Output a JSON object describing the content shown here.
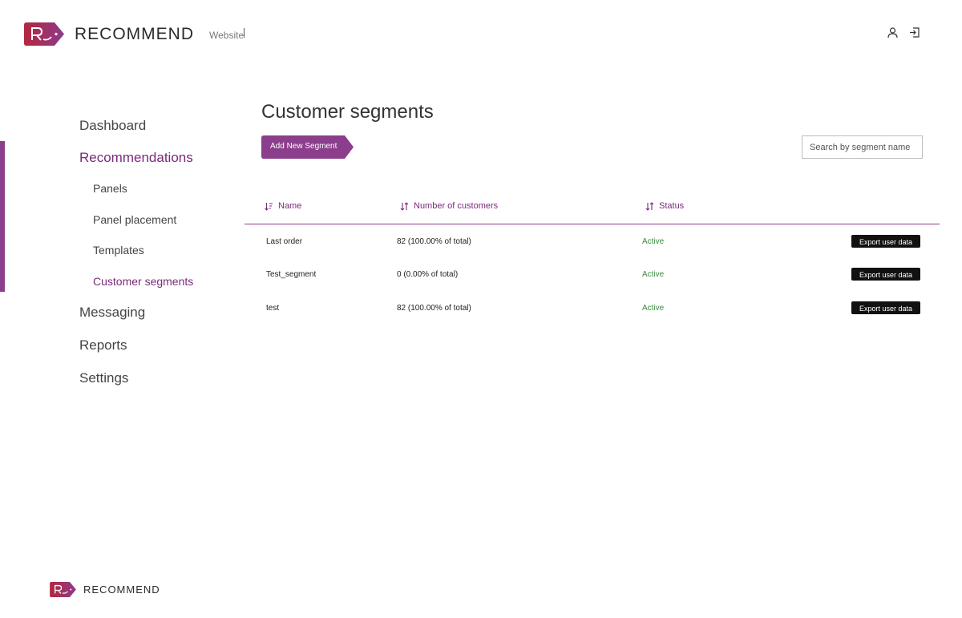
{
  "header": {
    "brand": "RECOMMEND",
    "website_label": "Website",
    "icons": [
      "user-icon",
      "logout-icon"
    ]
  },
  "sidebar": {
    "items": [
      {
        "label": "Dashboard",
        "level": "top",
        "active": false
      },
      {
        "label": "Recommendations",
        "level": "top",
        "active": true
      },
      {
        "label": "Panels",
        "level": "sub",
        "active": false
      },
      {
        "label": "Panel placement",
        "level": "sub",
        "active": false
      },
      {
        "label": "Templates",
        "level": "sub",
        "active": false
      },
      {
        "label": "Customer segments",
        "level": "sub",
        "active": true
      },
      {
        "label": "Messaging",
        "level": "top",
        "active": false
      },
      {
        "label": "Reports",
        "level": "top",
        "active": false
      },
      {
        "label": "Settings",
        "level": "top",
        "active": false
      }
    ]
  },
  "main": {
    "title": "Customer segments",
    "add_button_label": "Add New Segment",
    "search_placeholder": "Search by segment name",
    "search_value": ""
  },
  "table": {
    "columns": [
      {
        "label": "Name",
        "sort_icon": "sort-alpha-icon"
      },
      {
        "label": "Number of customers",
        "sort_icon": "sort-icon"
      },
      {
        "label": "Status",
        "sort_icon": "sort-icon"
      }
    ],
    "rows": [
      {
        "name": "Last order",
        "customers": "82 (100.00% of total)",
        "status": "Active",
        "action": "Export user data"
      },
      {
        "name": "Test_segment",
        "customers": "0 (0.00% of total)",
        "status": "Active",
        "action": "Export user data"
      },
      {
        "name": "test",
        "customers": "82 (100.00% of total)",
        "status": "Active",
        "action": "Export user data"
      }
    ]
  },
  "footer": {
    "brand": "RECOMMEND"
  },
  "colors": {
    "accent": "#8b3e8b",
    "accent_text": "#7a2a7a",
    "logo_red": "#b8294a",
    "status_active": "#3b8a3b",
    "button_dark": "#111111"
  }
}
